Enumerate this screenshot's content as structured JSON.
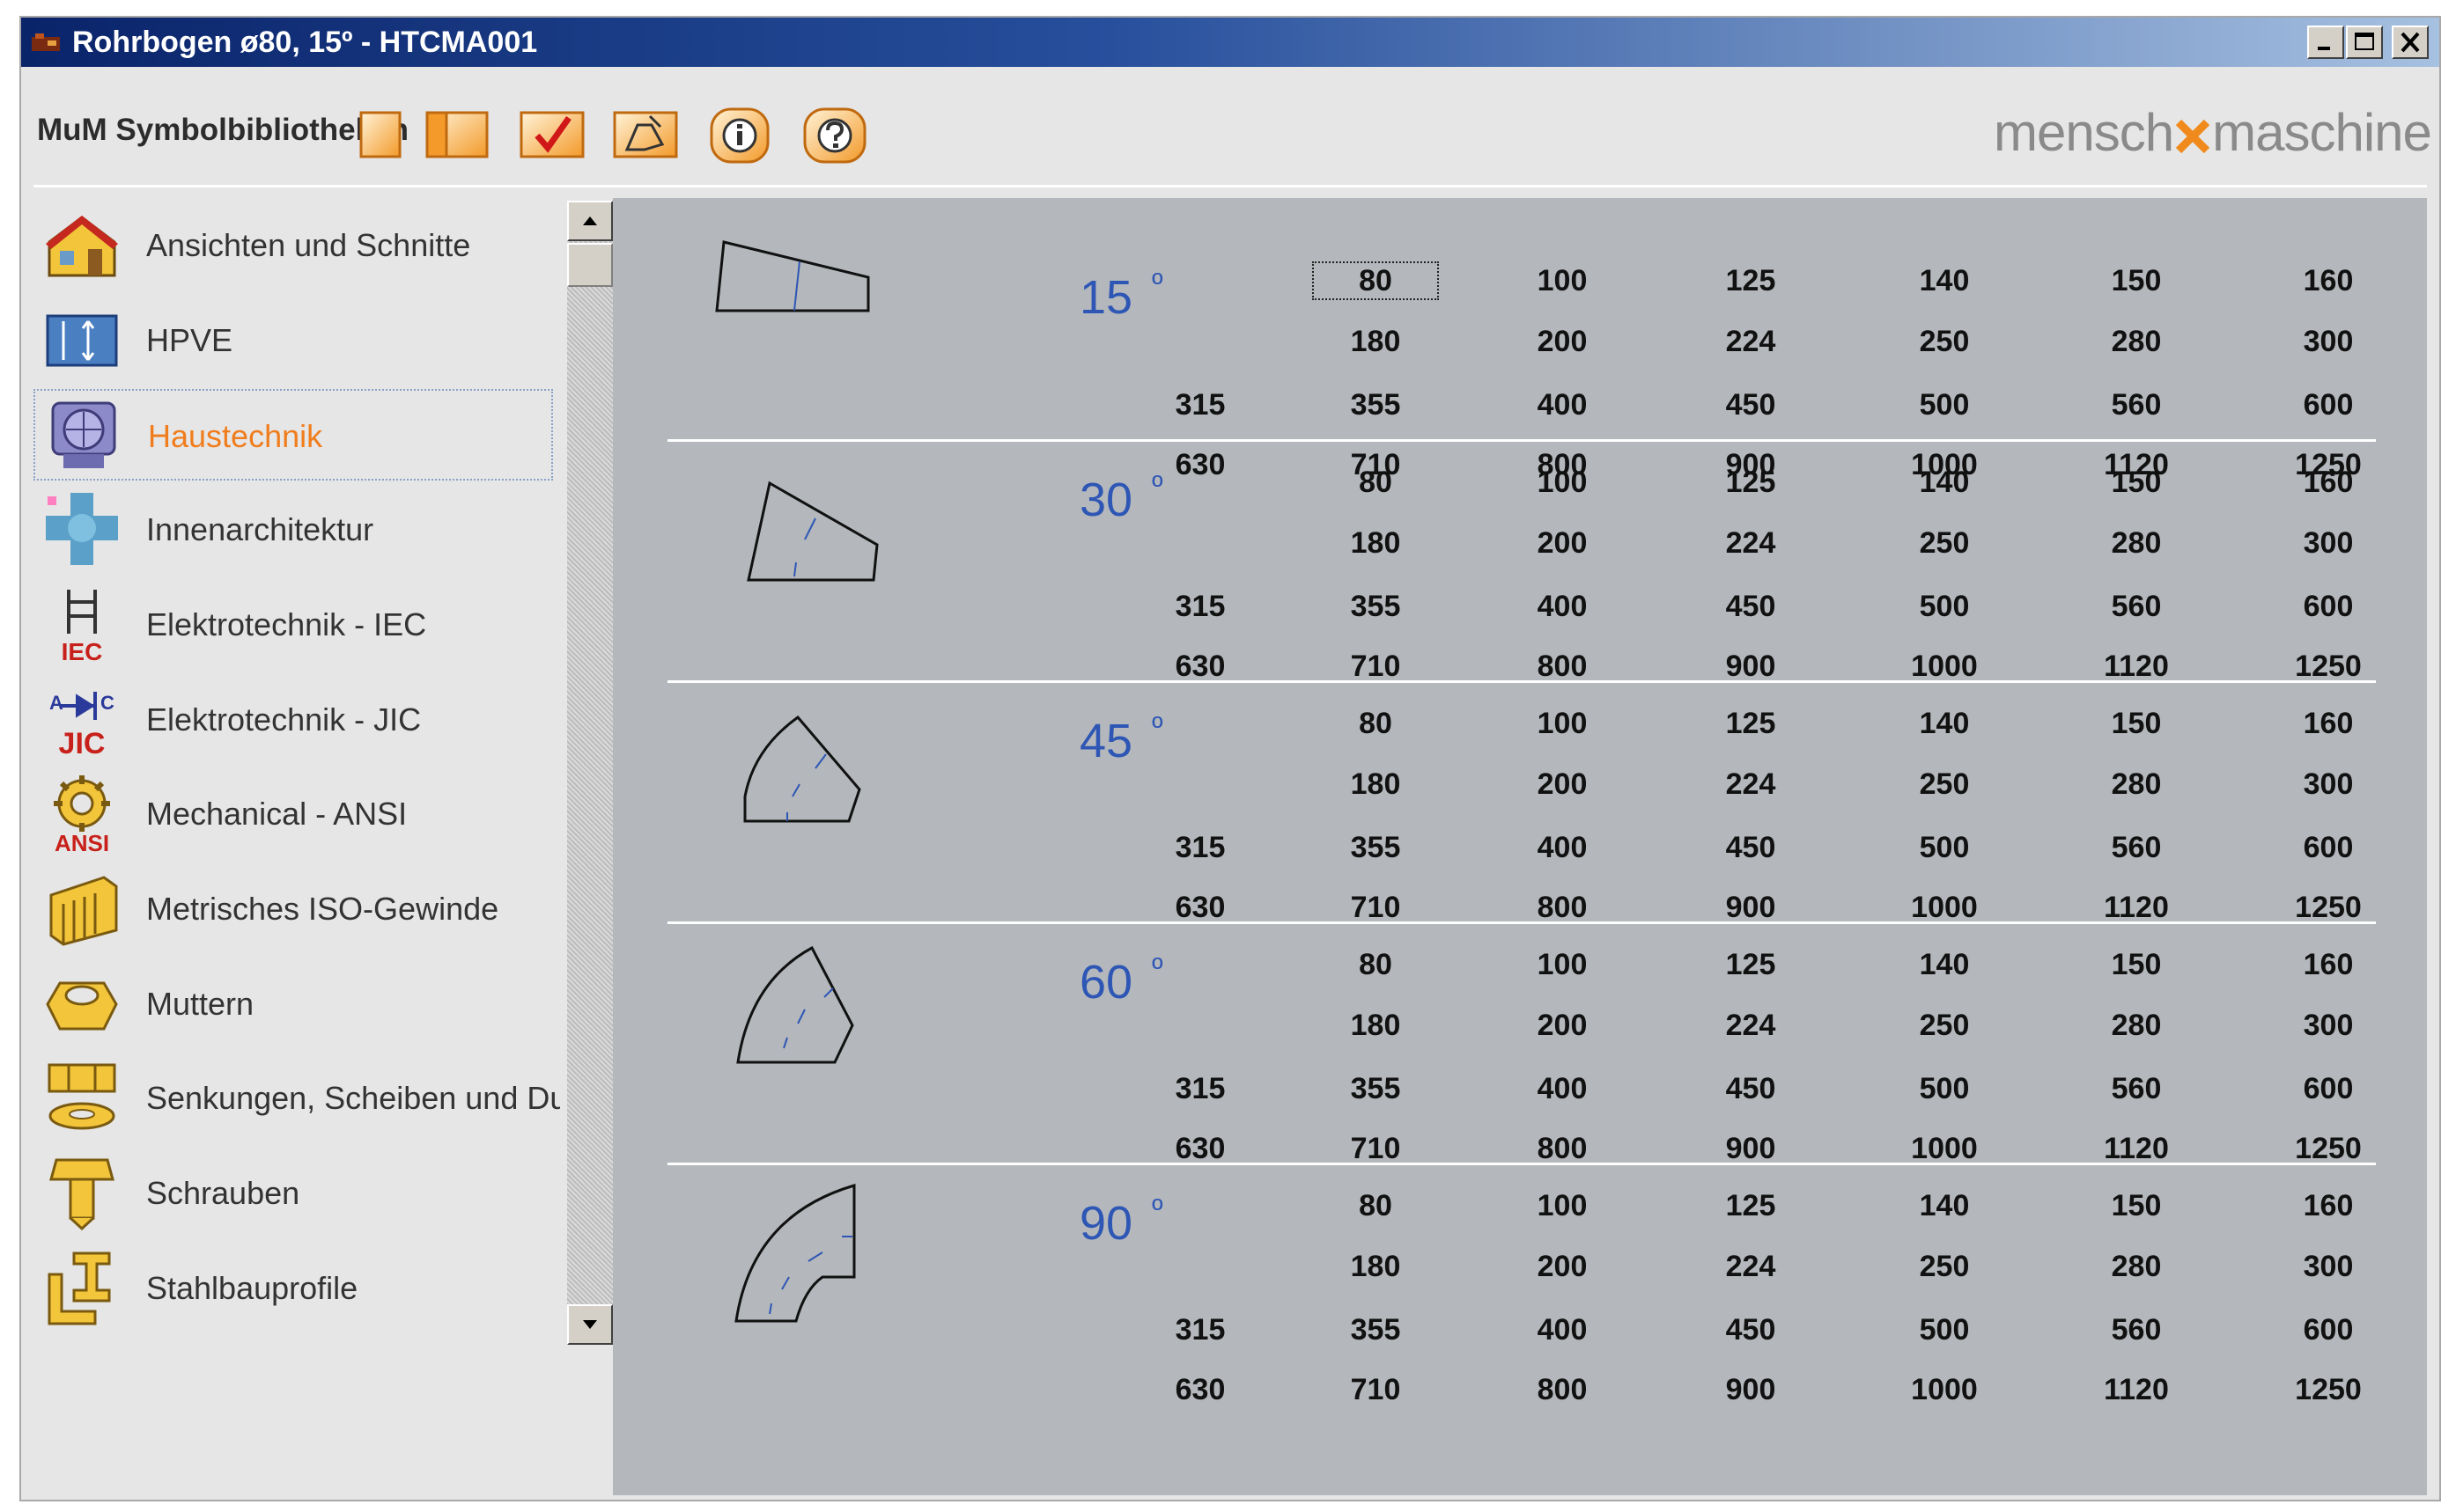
{
  "window": {
    "title": "Rohrbogen ø80, 15º - HTCMA001",
    "controls": [
      "minimize",
      "maximize",
      "close"
    ]
  },
  "header": {
    "library_title": "MuM Symbolbibliotheken",
    "logo": {
      "left": "mensch",
      "right": "maschine",
      "accent": "#f08a1c",
      "color": "#8a8a8a"
    },
    "toolbar": [
      {
        "name": "single-view-icon"
      },
      {
        "name": "split-view-icon"
      },
      {
        "name": "checkmark-icon"
      },
      {
        "name": "insert-symbol-icon"
      },
      {
        "name": "info-icon"
      },
      {
        "name": "help-icon"
      }
    ]
  },
  "sidebar": {
    "selected_index": 2,
    "items": [
      {
        "label": "Ansichten und Schnitte",
        "icon": "house-icon"
      },
      {
        "label": "HPVE",
        "icon": "hpve-icon"
      },
      {
        "label": "Haustechnik",
        "icon": "fan-unit-icon"
      },
      {
        "label": "Innenarchitektur",
        "icon": "interior-icon"
      },
      {
        "label": "Elektrotechnik - IEC",
        "icon": "iec-icon",
        "badge": "IEC"
      },
      {
        "label": "Elektrotechnik - JIC",
        "icon": "jic-icon",
        "badge": "JIC"
      },
      {
        "label": "Mechanical - ANSI",
        "icon": "gear-icon",
        "badge": "ANSI"
      },
      {
        "label": "Metrisches ISO-Gewinde",
        "icon": "thread-icon"
      },
      {
        "label": "Muttern",
        "icon": "nut-icon"
      },
      {
        "label": "Senkungen, Scheiben und Du",
        "icon": "washer-icon"
      },
      {
        "label": "Schrauben",
        "icon": "screw-icon"
      },
      {
        "label": "Stahlbauprofile",
        "icon": "steel-profile-icon"
      }
    ]
  },
  "content": {
    "focused_value": "80",
    "angle_unit": "º",
    "groups": [
      {
        "angle": "15"
      },
      {
        "angle": "30"
      },
      {
        "angle": "45"
      },
      {
        "angle": "60"
      },
      {
        "angle": "90"
      }
    ],
    "sizes": [
      [
        "",
        "80",
        "100",
        "125",
        "140",
        "150",
        "160"
      ],
      [
        "",
        "180",
        "200",
        "224",
        "250",
        "280",
        "300"
      ],
      [
        "315",
        "355",
        "400",
        "450",
        "500",
        "560",
        "600"
      ],
      [
        "630",
        "710",
        "800",
        "900",
        "1000",
        "1120",
        "1250"
      ]
    ]
  },
  "colors": {
    "title_bar": "#0a246a",
    "angle_text": "#2e56b5",
    "selected_item": "#f07d1d",
    "content_bg": "#b4b8bc",
    "toolbar_orange": "#f39a2a"
  }
}
